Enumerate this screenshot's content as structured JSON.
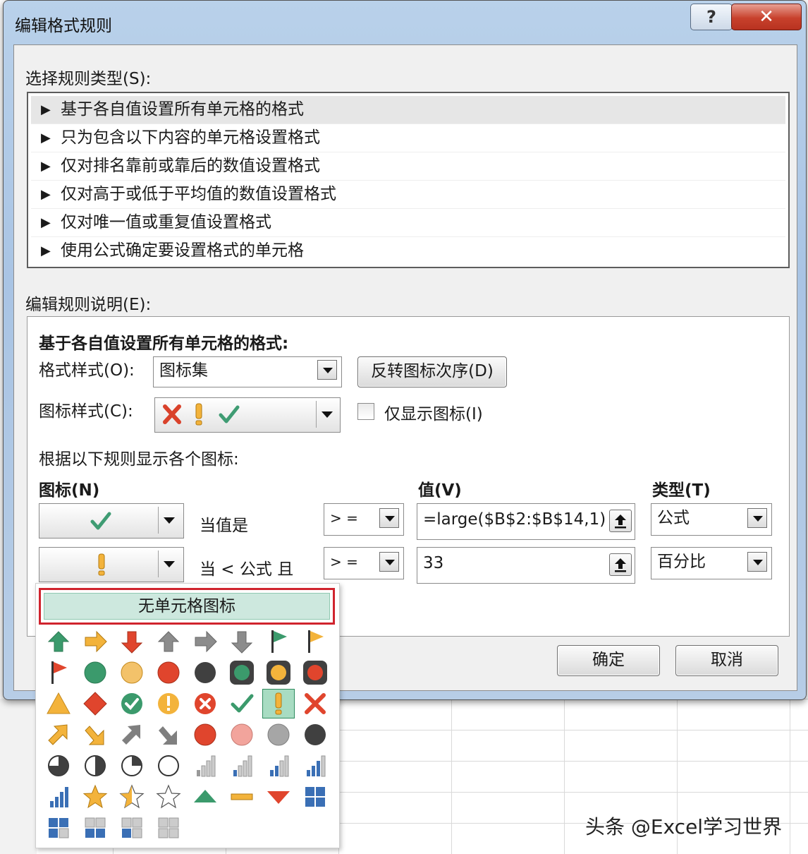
{
  "dialog": {
    "title": "编辑格式规则",
    "help_label": "?",
    "close_label": "✕",
    "select_rule_type_label": "选择规则类型(S):",
    "rule_types": [
      "基于各自值设置所有单元格的格式",
      "只为包含以下内容的单元格设置格式",
      "仅对排名靠前或靠后的数值设置格式",
      "仅对高于或低于平均值的数值设置格式",
      "仅对唯一值或重复值设置格式",
      "使用公式确定要设置格式的单元格"
    ],
    "selected_rule_index": 0,
    "edit_rule_desc_label": "编辑规则说明(E):",
    "desc_heading": "基于各自值设置所有单元格的格式:",
    "format_style_label": "格式样式(O):",
    "format_style_value": "图标集",
    "reverse_button": "反转图标次序(D)",
    "icon_style_label": "图标样式(C):",
    "icon_style_icons": [
      "red-x-icon",
      "yellow-exclamation-icon",
      "green-check-icon"
    ],
    "show_icon_only_label": "仅显示图标(I)",
    "show_icon_only_checked": false,
    "rules_heading": "根据以下规则显示各个图标:",
    "col_icon": "图标(N)",
    "col_value": "值(V)",
    "col_type": "类型(T)",
    "rows": [
      {
        "icon": "green-check-icon",
        "condition": "当值是",
        "operator": "> =",
        "value": "=large($B$2:$B$14,1)",
        "type": "公式"
      },
      {
        "icon": "yellow-exclamation-icon",
        "condition": "当 < 公式 且",
        "operator": "> =",
        "value": "33",
        "type": "百分比"
      }
    ],
    "ok_button": "确定",
    "cancel_button": "取消"
  },
  "icon_dropdown": {
    "no_icon_label": "无单元格图标",
    "selected_icon": "yellow-exclamation-icon",
    "icons": [
      "green-up-arrow-icon",
      "yellow-right-arrow-icon",
      "red-down-arrow-icon",
      "gray-up-arrow-icon",
      "gray-right-arrow-icon",
      "gray-down-arrow-icon",
      "green-flag-icon",
      "yellow-flag-icon",
      "red-flag-icon",
      "green-circle-icon",
      "yellow-circle-icon",
      "red-circle-icon",
      "black-circle-icon",
      "green-traffic-light-icon",
      "yellow-traffic-light-icon",
      "red-traffic-light-icon",
      "yellow-triangle-icon",
      "red-diamond-icon",
      "green-check-circle-icon",
      "yellow-exclamation-circle-icon",
      "red-x-circle-icon",
      "green-check-icon",
      "yellow-exclamation-icon",
      "red-x-icon",
      "yellow-up-right-arrow-icon",
      "yellow-down-right-arrow-icon",
      "gray-up-right-arrow-icon",
      "gray-down-right-arrow-icon",
      "red-circle-icon",
      "pink-circle-icon",
      "gray-circle-icon",
      "black-circle-icon",
      "three-quarter-pie-icon",
      "half-pie-icon",
      "quarter-pie-icon",
      "empty-circle-icon",
      "signal-bars-1-icon",
      "signal-bars-2-icon",
      "signal-bars-3-icon",
      "signal-bars-4-icon",
      "signal-bars-full-icon",
      "gold-star-icon",
      "half-star-icon",
      "empty-star-icon",
      "green-triangle-up-icon",
      "yellow-dash-icon",
      "red-triangle-down-icon",
      "boxes-4-icon",
      "boxes-3-icon",
      "boxes-2-icon",
      "boxes-1-icon",
      "boxes-0-icon"
    ]
  },
  "watermark": "头条 @Excel学习世界"
}
